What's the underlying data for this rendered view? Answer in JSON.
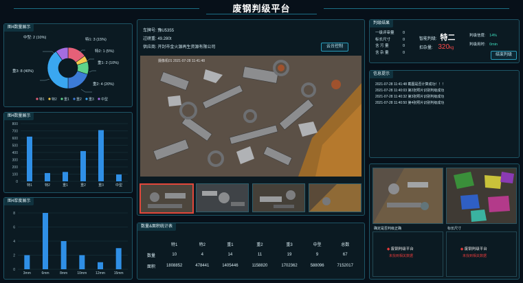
{
  "header": {
    "title": "废钢判级平台"
  },
  "pie_panel": {
    "title": "图4数量展示",
    "labels": [
      "中型: 2 (10%)",
      "特1: 3 (15%)",
      "特2: 1 (5%)",
      "重1: 2 (10%)",
      "重2: 4 (20%)",
      "重3: 8 (40%)"
    ],
    "legend": [
      "特1",
      "特2",
      "重1",
      "重2",
      "重3",
      "中型"
    ]
  },
  "bar_panel": {
    "title": "图4数量展示"
  },
  "thick_panel": {
    "title": "图4厚度展示"
  },
  "chart_data": [
    {
      "type": "pie",
      "categories": [
        "特1",
        "特2",
        "重1",
        "重2",
        "重3",
        "中型"
      ],
      "values": [
        3,
        1,
        2,
        4,
        8,
        2
      ],
      "colors": [
        "#e66078",
        "#f4c94d",
        "#5fd38a",
        "#3c7bd6",
        "#3aa7f0",
        "#a56de0"
      ]
    },
    {
      "type": "bar",
      "categories": [
        "特1",
        "特2",
        "重1",
        "重2",
        "重3",
        "中型"
      ],
      "values": [
        620,
        115,
        130,
        420,
        710,
        95
      ],
      "ylim": [
        0,
        800
      ],
      "yticks": [
        "0",
        "100",
        "200",
        "300",
        "400",
        "500",
        "600",
        "700",
        "800"
      ]
    },
    {
      "type": "bar",
      "categories": [
        "3mm",
        "6mm",
        "8mm",
        "10mm",
        "12mm",
        "15mm"
      ],
      "values": [
        2,
        8,
        4,
        2,
        1,
        3
      ],
      "ylim": [
        0,
        8
      ],
      "yticks": [
        "0",
        "2",
        "4",
        "6",
        "8"
      ]
    }
  ],
  "vehicle": {
    "plate_label": "车牌号:",
    "plate": "豫U5355",
    "weight_label": "过磅重:",
    "weight": "49.280t",
    "supplier_label": "供应商:",
    "supplier": "开封市金火源再生资源有限公司",
    "control_button": "云台控制",
    "photo_label": "摄像机01  2021-07-28  11:41:48"
  },
  "stats_table": {
    "title": "数量&面积统计表",
    "headers": [
      "",
      "特1",
      "特2",
      "重1",
      "重2",
      "重3",
      "中型",
      "总数"
    ],
    "rows": [
      {
        "label": "数量",
        "values": [
          "10",
          "4",
          "14",
          "11",
          "19",
          "9",
          "67"
        ]
      },
      {
        "label": "面积",
        "values": [
          "1808852",
          "478441",
          "1405446",
          "1158820",
          "1702362",
          "588096",
          "7152017"
        ]
      }
    ]
  },
  "result": {
    "title": "判级结果",
    "left_labels": [
      "一级评审量",
      "标长尺寸",
      "含 污 量",
      "含 杂 量"
    ],
    "left_values": [
      "0",
      "0",
      "0",
      "0"
    ],
    "grade_label": "智能判级:",
    "grade_value": "特二",
    "deduct_label": "扣杂量:",
    "deduct_value": "320",
    "deduct_unit": "kg",
    "confidence_label": "判级信度:",
    "confidence_value": "14%",
    "time_label": "判级用时:",
    "time_value": "0min",
    "end_button": "结束判级"
  },
  "messages": {
    "title": "信息提示",
    "items": [
      {
        "time": "2021-07-28 11:41:48",
        "text": "截图是否计算成功！！！"
      },
      {
        "time": "2021-07-28 11:40:03",
        "text": "第2张照片识别判级成功"
      },
      {
        "time": "2021-07-28 11:40:32",
        "text": "第3张照片识别判级成功"
      },
      {
        "time": "2021-07-28 11:40:50",
        "text": "第4张照片识别判级成功"
      }
    ]
  },
  "review": {
    "label_left": "确定是否判级正确",
    "label_right": "标长尺寸",
    "logo_text": "废钢判级平台",
    "warn_left": "未找到相关数据",
    "warn_right": "未找到相关数据"
  }
}
